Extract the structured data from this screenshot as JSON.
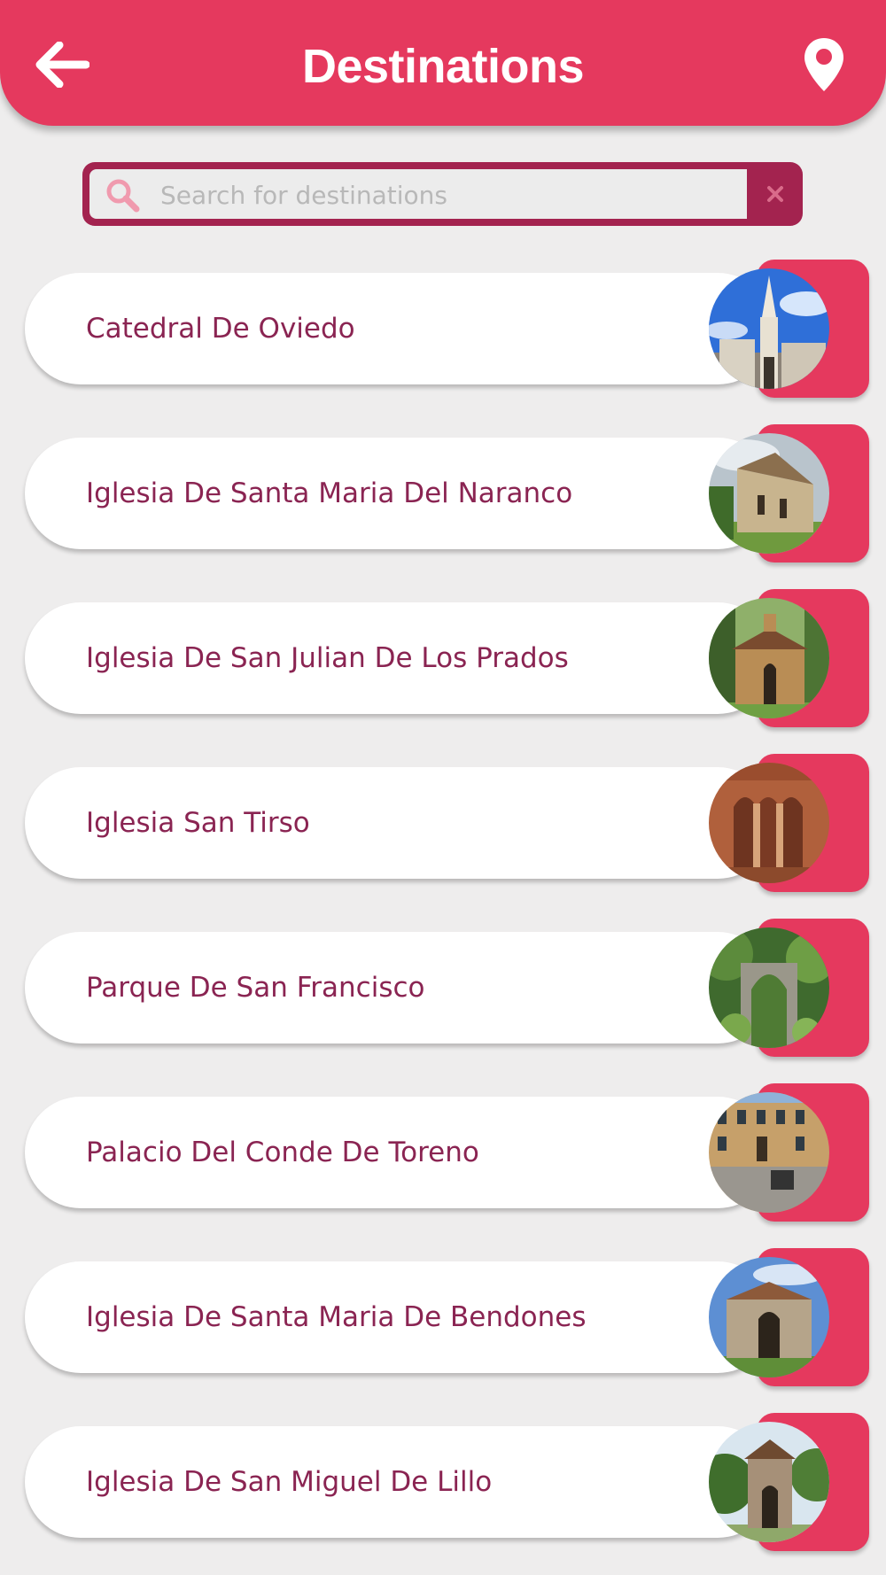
{
  "header": {
    "title": "Destinations",
    "back_icon": "arrow-left-icon",
    "location_icon": "map-pin-icon"
  },
  "search": {
    "placeholder": "Search for destinations",
    "value": "",
    "search_icon": "magnifier-icon",
    "clear_icon": "close-icon"
  },
  "colors": {
    "primary": "#e5395e",
    "dark_accent": "#a3234f",
    "label_text": "#8a2452",
    "background": "#eeeded"
  },
  "destinations": [
    {
      "name": "Catedral De Oviedo"
    },
    {
      "name": "Iglesia De Santa Maria Del Naranco"
    },
    {
      "name": "Iglesia De San Julian De Los Prados"
    },
    {
      "name": "Iglesia San Tirso"
    },
    {
      "name": "Parque De San Francisco"
    },
    {
      "name": "Palacio Del Conde De Toreno"
    },
    {
      "name": "Iglesia De Santa Maria De Bendones"
    },
    {
      "name": "Iglesia De San Miguel De Lillo"
    }
  ]
}
